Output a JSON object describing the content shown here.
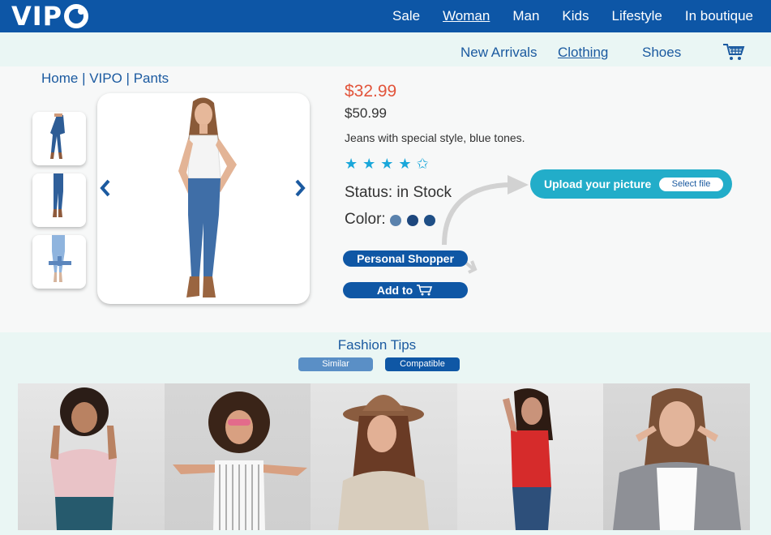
{
  "brand": {
    "logo_text": "VIP"
  },
  "topnav": [
    "Sale",
    "Woman",
    "Man",
    "Kids",
    "Lifestyle",
    "In boutique"
  ],
  "subnav": [
    "New Arrivals",
    "Clothing",
    "Shoes"
  ],
  "breadcrumb": "Home | VIPO | Pants",
  "product": {
    "price_new": "$32.99",
    "price_old": "$50.99",
    "description": "Jeans with special style, blue tones.",
    "rating": 4.5,
    "status": "Status: in Stock",
    "color_label": "Color:",
    "colors": [
      "#5a82ad",
      "#1d477d",
      "#1f4f86"
    ]
  },
  "actions": {
    "personal_shopper": "Personal Shopper",
    "add_to": "Add to"
  },
  "upload": {
    "label": "Upload your picture",
    "select_file": "Select file"
  },
  "tips": {
    "title": "Fashion Tips",
    "similar": "Similar",
    "compatible": "Compatible"
  },
  "colors": {
    "brand_blue": "#0d56a6",
    "accent_red": "#e2553c",
    "star_blue": "#1aa7da",
    "upload_teal": "#22adc9"
  }
}
